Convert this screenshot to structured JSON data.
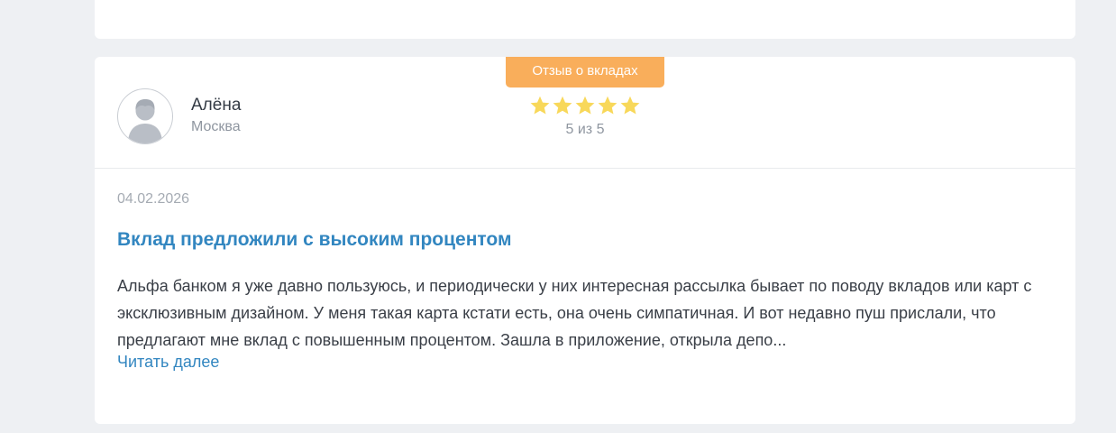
{
  "review": {
    "category_badge": "Отзыв о вкладах",
    "author": {
      "name": "Алёна",
      "city": "Москва",
      "avatar_icon": "user-silhouette-icon"
    },
    "rating": {
      "value": 5,
      "max": 5,
      "text": "5 из 5",
      "star_color": "#f8d85a",
      "star_icon": "star-icon"
    },
    "date": "04.02.2026",
    "title": "Вклад предложили с высоким процентом",
    "body": "Альфа банком я уже давно пользуюсь, и периодически у них интересная рассылка бывает по поводу вкладов или карт с эксклюзивным дизайном. У меня такая карта кстати есть, она очень симпатичная. И вот недавно пуш прислали, что предлагают мне вклад с повышенным процентом. Зашла в приложение, открыла депо...",
    "read_more_label": "Читать далее"
  },
  "colors": {
    "badge": "#f9ae5b",
    "link": "#3286c0",
    "background": "#eef0f3"
  }
}
